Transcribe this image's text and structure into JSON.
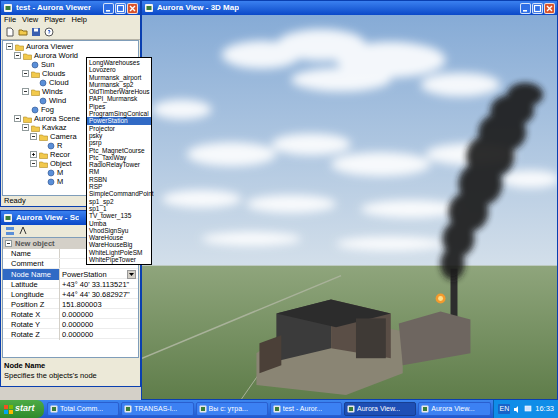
{
  "main_window": {
    "title": "test - Aurora Viewer",
    "menu": [
      "File",
      "View",
      "Player",
      "Help"
    ],
    "tree": [
      {
        "label": "Aurora Viewer",
        "expanded": true,
        "children": [
          {
            "label": "Aurora World",
            "expanded": true,
            "children": [
              {
                "label": "Sun"
              },
              {
                "label": "Clouds",
                "expanded": true,
                "children": [
                  {
                    "label": "Cloud"
                  }
                ]
              },
              {
                "label": "Winds",
                "expanded": true,
                "children": [
                  {
                    "label": "Wind"
                  }
                ]
              },
              {
                "label": "Fog"
              }
            ]
          },
          {
            "label": "Aurora Scene",
            "expanded": true,
            "children": [
              {
                "label": "Kavkaz",
                "expanded": true,
                "children": [
                  {
                    "label": "Camera",
                    "expanded": true,
                    "children": [
                      {
                        "label": "R"
                      }
                    ]
                  },
                  {
                    "label": "Recor",
                    "expanded": false,
                    "children": []
                  },
                  {
                    "label": "Object",
                    "expanded": true,
                    "children": [
                      {
                        "label": "M"
                      },
                      {
                        "label": "M"
                      }
                    ]
                  }
                ]
              }
            ]
          }
        ]
      }
    ],
    "status": "Ready"
  },
  "dropdown": {
    "items": [
      {
        "label": "LongWarehouses",
        "selected": false
      },
      {
        "label": "Lovozero",
        "selected": false
      },
      {
        "label": "Murmansk_airport",
        "selected": false
      },
      {
        "label": "Murmansk_sp2",
        "selected": false
      },
      {
        "label": "OldTimberWareHous",
        "selected": false
      },
      {
        "label": "PAPI_Murmansk",
        "selected": false
      },
      {
        "label": "Pipes",
        "selected": false
      },
      {
        "label": "ProgramSingConical",
        "selected": false
      },
      {
        "label": "PowerStation",
        "selected": true
      },
      {
        "label": "Projector",
        "selected": false
      },
      {
        "label": "psky",
        "selected": false
      },
      {
        "label": "psrp",
        "selected": false
      },
      {
        "label": "Ptc_MagnetCourse",
        "selected": false
      },
      {
        "label": "Ptc_TaxiWay",
        "selected": false
      },
      {
        "label": "RadioRelayTower",
        "selected": false
      },
      {
        "label": "RM",
        "selected": false
      },
      {
        "label": "RSBN",
        "selected": false
      },
      {
        "label": "RSP",
        "selected": false
      },
      {
        "label": "SimpleCommandPoint",
        "selected": false
      },
      {
        "label": "sp1_sp2",
        "selected": false
      },
      {
        "label": "sp1_1",
        "selected": false
      },
      {
        "label": "TV_tower_135",
        "selected": false
      },
      {
        "label": "Umba",
        "selected": false
      },
      {
        "label": "VhodSignSyu",
        "selected": false
      },
      {
        "label": "WareHouse",
        "selected": false
      },
      {
        "label": "WareHouseBig",
        "selected": false
      },
      {
        "label": "WhiteLightPoleSM",
        "selected": false
      },
      {
        "label": "WhitePipeTower",
        "selected": false
      }
    ]
  },
  "props_window": {
    "title": "Aurora View - Sc",
    "category": {
      "label": "New object",
      "expanded": true
    },
    "rows": [
      {
        "name": "Name",
        "value": "",
        "kind": "text",
        "selected": false
      },
      {
        "name": "Comment",
        "value": "",
        "kind": "text",
        "selected": false
      },
      {
        "name": "Node Name",
        "value": "PowerStation",
        "kind": "dropdown",
        "selected": true
      },
      {
        "name": "Latitude",
        "value": "+43° 40' 33.113521\"",
        "kind": "text",
        "selected": false
      },
      {
        "name": "Longitude",
        "value": "+44° 44' 30.682927\"",
        "kind": "text",
        "selected": false
      },
      {
        "name": "Position Z",
        "value": "151.800003",
        "kind": "text",
        "selected": false
      },
      {
        "name": "Rotate X",
        "value": "0.000000",
        "kind": "text",
        "selected": false
      },
      {
        "name": "Rotate Y",
        "value": "0.000000",
        "kind": "text",
        "selected": false
      },
      {
        "name": "Rotate Z",
        "value": "0.000000",
        "kind": "text",
        "selected": false
      }
    ],
    "help_title": "Node Name",
    "help_text": "Specifies the objects's node"
  },
  "map_window": {
    "title": "Aurora View - 3D Map"
  },
  "taskbar": {
    "start": "start",
    "tasks": [
      {
        "label": "Total Comm...",
        "selected": false
      },
      {
        "label": "TRANSAS-I...",
        "selected": false
      },
      {
        "label": "Вы с: утра...",
        "selected": false
      },
      {
        "label": "test - Auror...",
        "selected": false
      },
      {
        "label": "Aurora View...",
        "selected": true
      },
      {
        "label": "Aurora View...",
        "selected": false
      }
    ],
    "lang": "EN",
    "clock": "16:33"
  }
}
